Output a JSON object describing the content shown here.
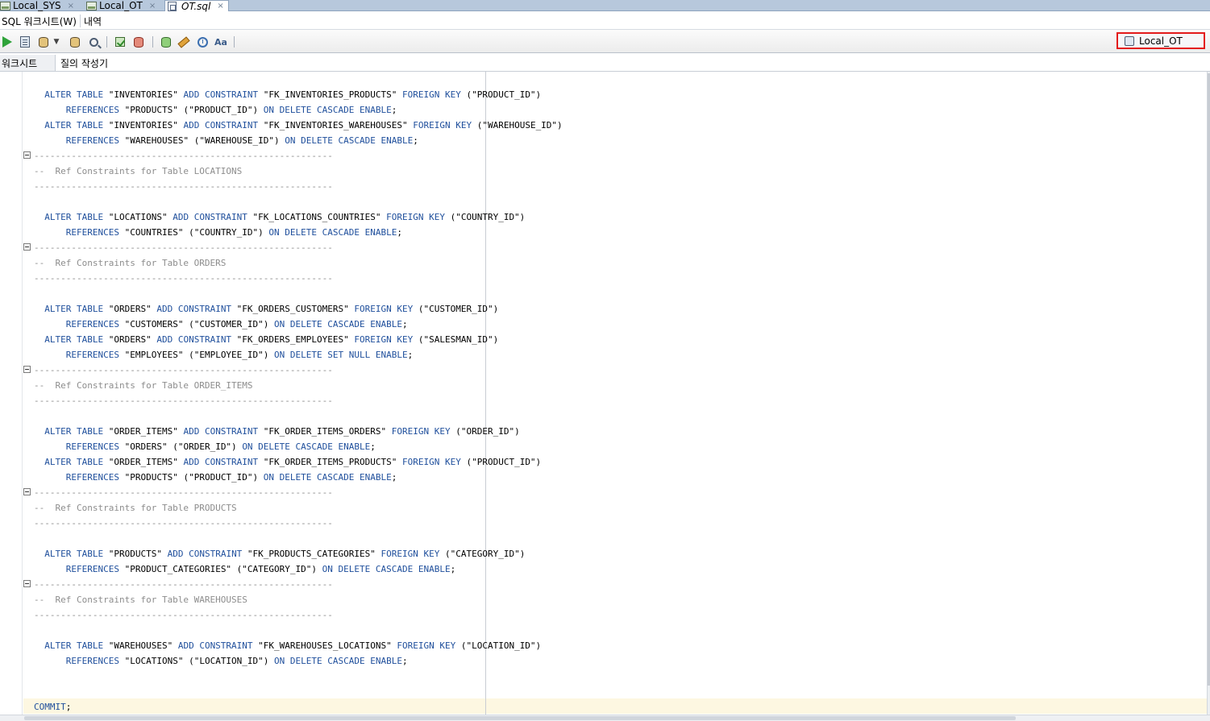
{
  "tabs": [
    {
      "label": "Local_SYS",
      "close": "×"
    },
    {
      "label": "Local_OT",
      "close": "×"
    },
    {
      "label": "OT.sql",
      "close": "×"
    }
  ],
  "subtabs": {
    "worksheet": "SQL 워크시트(W)",
    "history": "내역"
  },
  "toolbar": {
    "buttons": [
      "run-statement",
      "run-script",
      "commit",
      "rollback",
      "autotrace",
      "explain-plan",
      "tuning-advisor",
      "clear",
      "sql-history",
      "to-uppercase"
    ],
    "icon_text": "Aa",
    "connection": "Local_OT"
  },
  "worksheet_tabs": {
    "worksheet": "워크시트",
    "query_builder": "질의 작성기"
  },
  "editor": {
    "lines": [
      [
        {
          "t": "  "
        },
        {
          "k": "ALTER TABLE"
        },
        {
          "t": " \"INVENTORIES\" "
        },
        {
          "k": "ADD CONSTRAINT"
        },
        {
          "t": " \"FK_INVENTORIES_PRODUCTS\" "
        },
        {
          "k": "FOREIGN KEY"
        },
        {
          "t": " (\"PRODUCT_ID\")"
        }
      ],
      [
        {
          "t": "      "
        },
        {
          "k": "REFERENCES"
        },
        {
          "t": " \"PRODUCTS\" (\"PRODUCT_ID\") "
        },
        {
          "k": "ON DELETE CASCADE ENABLE"
        },
        {
          "t": ";"
        }
      ],
      [
        {
          "t": "  "
        },
        {
          "k": "ALTER TABLE"
        },
        {
          "t": " \"INVENTORIES\" "
        },
        {
          "k": "ADD CONSTRAINT"
        },
        {
          "t": " \"FK_INVENTORIES_WAREHOUSES\" "
        },
        {
          "k": "FOREIGN KEY"
        },
        {
          "t": " (\"WAREHOUSE_ID\")"
        }
      ],
      [
        {
          "t": "      "
        },
        {
          "k": "REFERENCES"
        },
        {
          "t": " \"WAREHOUSES\" (\"WAREHOUSE_ID\") "
        },
        {
          "k": "ON DELETE CASCADE ENABLE"
        },
        {
          "t": ";"
        }
      ],
      [
        {
          "c": "--------------------------------------------------------"
        }
      ],
      [
        {
          "c": "--  Ref Constraints for Table LOCATIONS"
        }
      ],
      [
        {
          "c": "--------------------------------------------------------"
        }
      ],
      [],
      [
        {
          "t": "  "
        },
        {
          "k": "ALTER TABLE"
        },
        {
          "t": " \"LOCATIONS\" "
        },
        {
          "k": "ADD CONSTRAINT"
        },
        {
          "t": " \"FK_LOCATIONS_COUNTRIES\" "
        },
        {
          "k": "FOREIGN KEY"
        },
        {
          "t": " (\"COUNTRY_ID\")"
        }
      ],
      [
        {
          "t": "      "
        },
        {
          "k": "REFERENCES"
        },
        {
          "t": " \"COUNTRIES\" (\"COUNTRY_ID\") "
        },
        {
          "k": "ON DELETE CASCADE ENABLE"
        },
        {
          "t": ";"
        }
      ],
      [
        {
          "c": "--------------------------------------------------------"
        }
      ],
      [
        {
          "c": "--  Ref Constraints for Table ORDERS"
        }
      ],
      [
        {
          "c": "--------------------------------------------------------"
        }
      ],
      [],
      [
        {
          "t": "  "
        },
        {
          "k": "ALTER TABLE"
        },
        {
          "t": " \"ORDERS\" "
        },
        {
          "k": "ADD CONSTRAINT"
        },
        {
          "t": " \"FK_ORDERS_CUSTOMERS\" "
        },
        {
          "k": "FOREIGN KEY"
        },
        {
          "t": " (\"CUSTOMER_ID\")"
        }
      ],
      [
        {
          "t": "      "
        },
        {
          "k": "REFERENCES"
        },
        {
          "t": " \"CUSTOMERS\" (\"CUSTOMER_ID\") "
        },
        {
          "k": "ON DELETE CASCADE ENABLE"
        },
        {
          "t": ";"
        }
      ],
      [
        {
          "t": "  "
        },
        {
          "k": "ALTER TABLE"
        },
        {
          "t": " \"ORDERS\" "
        },
        {
          "k": "ADD CONSTRAINT"
        },
        {
          "t": " \"FK_ORDERS_EMPLOYEES\" "
        },
        {
          "k": "FOREIGN KEY"
        },
        {
          "t": " (\"SALESMAN_ID\")"
        }
      ],
      [
        {
          "t": "      "
        },
        {
          "k": "REFERENCES"
        },
        {
          "t": " \"EMPLOYEES\" (\"EMPLOYEE_ID\") "
        },
        {
          "k": "ON DELETE SET NULL ENABLE"
        },
        {
          "t": ";"
        }
      ],
      [
        {
          "c": "--------------------------------------------------------"
        }
      ],
      [
        {
          "c": "--  Ref Constraints for Table ORDER_ITEMS"
        }
      ],
      [
        {
          "c": "--------------------------------------------------------"
        }
      ],
      [],
      [
        {
          "t": "  "
        },
        {
          "k": "ALTER TABLE"
        },
        {
          "t": " \"ORDER_ITEMS\" "
        },
        {
          "k": "ADD CONSTRAINT"
        },
        {
          "t": " \"FK_ORDER_ITEMS_ORDERS\" "
        },
        {
          "k": "FOREIGN KEY"
        },
        {
          "t": " (\"ORDER_ID\")"
        }
      ],
      [
        {
          "t": "      "
        },
        {
          "k": "REFERENCES"
        },
        {
          "t": " \"ORDERS\" (\"ORDER_ID\") "
        },
        {
          "k": "ON DELETE CASCADE ENABLE"
        },
        {
          "t": ";"
        }
      ],
      [
        {
          "t": "  "
        },
        {
          "k": "ALTER TABLE"
        },
        {
          "t": " \"ORDER_ITEMS\" "
        },
        {
          "k": "ADD CONSTRAINT"
        },
        {
          "t": " \"FK_ORDER_ITEMS_PRODUCTS\" "
        },
        {
          "k": "FOREIGN KEY"
        },
        {
          "t": " (\"PRODUCT_ID\")"
        }
      ],
      [
        {
          "t": "      "
        },
        {
          "k": "REFERENCES"
        },
        {
          "t": " \"PRODUCTS\" (\"PRODUCT_ID\") "
        },
        {
          "k": "ON DELETE CASCADE ENABLE"
        },
        {
          "t": ";"
        }
      ],
      [
        {
          "c": "--------------------------------------------------------"
        }
      ],
      [
        {
          "c": "--  Ref Constraints for Table PRODUCTS"
        }
      ],
      [
        {
          "c": "--------------------------------------------------------"
        }
      ],
      [],
      [
        {
          "t": "  "
        },
        {
          "k": "ALTER TABLE"
        },
        {
          "t": " \"PRODUCTS\" "
        },
        {
          "k": "ADD CONSTRAINT"
        },
        {
          "t": " \"FK_PRODUCTS_CATEGORIES\" "
        },
        {
          "k": "FOREIGN KEY"
        },
        {
          "t": " (\"CATEGORY_ID\")"
        }
      ],
      [
        {
          "t": "      "
        },
        {
          "k": "REFERENCES"
        },
        {
          "t": " \"PRODUCT_CATEGORIES\" (\"CATEGORY_ID\") "
        },
        {
          "k": "ON DELETE CASCADE ENABLE"
        },
        {
          "t": ";"
        }
      ],
      [
        {
          "c": "--------------------------------------------------------"
        }
      ],
      [
        {
          "c": "--  Ref Constraints for Table WAREHOUSES"
        }
      ],
      [
        {
          "c": "--------------------------------------------------------"
        }
      ],
      [],
      [
        {
          "t": "  "
        },
        {
          "k": "ALTER TABLE"
        },
        {
          "t": " \"WAREHOUSES\" "
        },
        {
          "k": "ADD CONSTRAINT"
        },
        {
          "t": " \"FK_WAREHOUSES_LOCATIONS\" "
        },
        {
          "k": "FOREIGN KEY"
        },
        {
          "t": " (\"LOCATION_ID\")"
        }
      ],
      [
        {
          "t": "      "
        },
        {
          "k": "REFERENCES"
        },
        {
          "t": " \"LOCATIONS\" (\"LOCATION_ID\") "
        },
        {
          "k": "ON DELETE CASCADE ENABLE"
        },
        {
          "t": ";"
        }
      ],
      [],
      [],
      [
        {
          "k": "COMMIT"
        },
        {
          "t": ";"
        }
      ]
    ]
  }
}
